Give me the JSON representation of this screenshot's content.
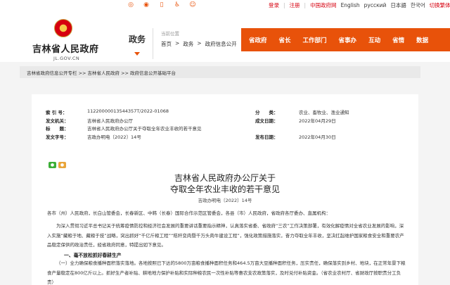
{
  "topbar": {
    "icons": [
      "rss-icon",
      "weibo-icon",
      "mobile-icon",
      "accessibility-icon",
      "mascot-icon"
    ],
    "links": [
      "登录",
      "注册",
      "中国政府网",
      "English",
      "русский",
      "日本語",
      "한국어",
      "切换繁体"
    ]
  },
  "header": {
    "site_title": "吉林省人民政府",
    "site_domain": "JL.GOV.CN",
    "section": "政务",
    "location_label": "当前位置",
    "crumbs": [
      "首页",
      ">",
      "政务",
      ">",
      "政府信息公开"
    ]
  },
  "nav": {
    "items": [
      "省政府",
      "省长",
      "工作部门",
      "省事办",
      "互动",
      "省情",
      "数据"
    ]
  },
  "breadcrumb": "吉林省政府信息公开专栏 >> 吉林省人民政府 >> 政府信息公开基础平台",
  "meta": {
    "rows": [
      {
        "k1": "索  引  号：",
        "v1": "11220000013544357T/2022-01068",
        "k2": "分　　类：",
        "v2": "农业、畜牧业、渔业通知"
      },
      {
        "k1": "发文机关：",
        "v1": "吉林省人民政府办公厅",
        "k2": "成文日期：",
        "v2": "2022年04月29日"
      },
      {
        "k1": "标　　题：",
        "v1": "吉林省人民政府办公厅关于夺取全年农业丰收的若干意见",
        "k2": "",
        "v2": ""
      },
      {
        "k1": "发文字号：",
        "v1": "吉政办明电〔2022〕14号",
        "k2": "发布日期：",
        "v2": "2022年04月30日"
      }
    ]
  },
  "document": {
    "title_line1": "吉林省人民政府办公厅关于",
    "title_line2": "夺取全年农业丰收的若干意见",
    "doc_number": "吉政办明电〔2022〕14号",
    "salutation": "各市（州）人民政府，长白山管委会，长春新区、中韩（长春）国际合作示范区管委会，各县（市）人民政府，省政府各厅委办、直属机构：",
    "para1": "为深入贯彻习近平总书记关于统筹疫情防控和经济社会发展的重要讲话重要指示精神，认真落实省委、省政府“三农”工作决策部署，有效化解疫情对全省农业发展的影响，深入实施“藏粮于地、藏粮于技”战略，突出抓好“千亿斤粮工程”“秸秆变肉暨千万头肉牛建设工程”，强化政策措施落实，奋力夺取全年丰收，坚决扛起维护国家粮食安全和重要农产品稳定保供的政治责任，经省政府同意，特提出如下意见。",
    "heading1": "一、毫不放松抓好春耕生产",
    "para2": "（一）全力确保粮食播种面积落实落地。各地按照已下达的5800万亩粮食播种面积任务和464.5万亩大豆播种面积任务，压实责任，确保落实到乡村、地块，在正常年景下粮食产量稳定在800亿斤以上。抓好生产者补贴、耕地地力保护补贴和实际种粮农民一次性补贴等惠农支农政策落实，及时兑付补贴资金。（省农业农村厅、省财政厅按职责分工负责）"
  }
}
